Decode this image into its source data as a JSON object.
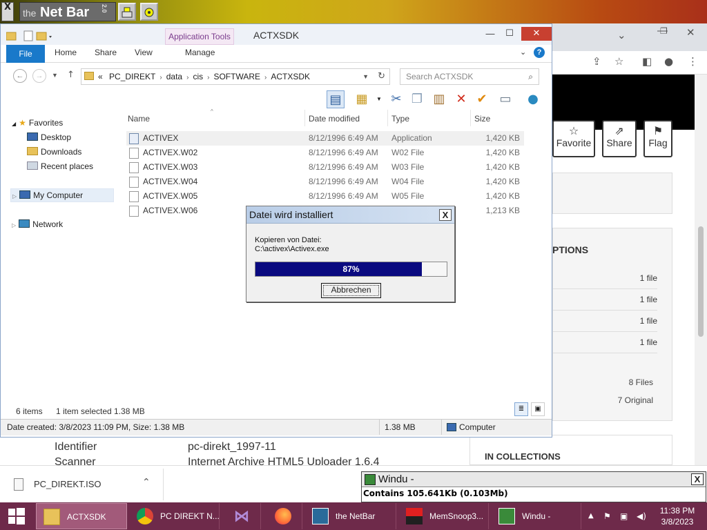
{
  "netbar": {
    "logo_prefix": "the",
    "logo_name": "Net Bar",
    "version": "2.0",
    "close_glyph": "X"
  },
  "browser": {
    "actions": [
      "Favorite",
      "Share",
      "Flag"
    ],
    "options_title": "PTIONS",
    "option_rows": [
      "1 file",
      "1 file",
      "1 file",
      "1 file"
    ],
    "files_count": "8 Files",
    "original_count": "7 Original",
    "collections_title": "IN COLLECTIONS"
  },
  "metadata": [
    {
      "label": "Identifier",
      "value": "pc-direkt_1997-11"
    },
    {
      "label": "Scanner",
      "value": "Internet Archive HTML5 Uploader 1.6.4"
    }
  ],
  "explorer": {
    "title": "ACTXSDK",
    "app_tools": "Application Tools",
    "tabs": {
      "file": "File",
      "home": "Home",
      "share": "Share",
      "view": "View",
      "manage": "Manage"
    },
    "breadcrumb": [
      "PC_DIREKT",
      "data",
      "cis",
      "SOFTWARE",
      "ACTXSDK"
    ],
    "breadcrumb_prefix": "«",
    "search_placeholder": "Search ACTXSDK",
    "nav": {
      "favorites": "Favorites",
      "desktop": "Desktop",
      "downloads": "Downloads",
      "recent": "Recent places",
      "computer": "My Computer",
      "network": "Network"
    },
    "columns": {
      "name": "Name",
      "date": "Date modified",
      "type": "Type",
      "size": "Size"
    },
    "files": [
      {
        "name": "ACTIVEX",
        "date": "8/12/1996 6:49 AM",
        "type": "Application",
        "size": "1,420 KB"
      },
      {
        "name": "ACTIVEX.W02",
        "date": "8/12/1996 6:49 AM",
        "type": "W02 File",
        "size": "1,420 KB"
      },
      {
        "name": "ACTIVEX.W03",
        "date": "8/12/1996 6:49 AM",
        "type": "W03 File",
        "size": "1,420 KB"
      },
      {
        "name": "ACTIVEX.W04",
        "date": "8/12/1996 6:49 AM",
        "type": "W04 File",
        "size": "1,420 KB"
      },
      {
        "name": "ACTIVEX.W05",
        "date": "8/12/1996 6:49 AM",
        "type": "W05 File",
        "size": "1,420 KB"
      },
      {
        "name": "ACTIVEX.W06",
        "date": "",
        "type": "",
        "size": "1,213 KB"
      }
    ],
    "status": {
      "items": "6 items",
      "selected": "1 item selected  1.38 MB"
    },
    "details": {
      "created": "Date created: 3/8/2023 11:09 PM, Size: 1.38 MB",
      "size": "1.38 MB",
      "location": "Computer"
    }
  },
  "dialog": {
    "title": "Datei wird installiert",
    "line1": "Kopieren von Datei:",
    "line2": "C:\\activex\\Activex.exe",
    "progress_label": "87%",
    "progress": 0.87,
    "cancel": "Abbrechen",
    "close_glyph": "X"
  },
  "downloads": {
    "file": "PC_DIREKT.ISO"
  },
  "windu": {
    "title": "Windu -",
    "body": "Contains 105.641Kb (0.103Mb)",
    "close_glyph": "X"
  },
  "taskbar": {
    "items": [
      "ACTXSDK",
      "PC DIREKT N...",
      "",
      "",
      "the NetBar",
      "MemSnoop3...",
      "Windu -"
    ],
    "time": "11:38 PM",
    "date": "3/8/2023"
  },
  "colors": {
    "taskbar": "#6e2a4a",
    "file_tab": "#1979ca",
    "progress_fill": "#0a0a80"
  }
}
